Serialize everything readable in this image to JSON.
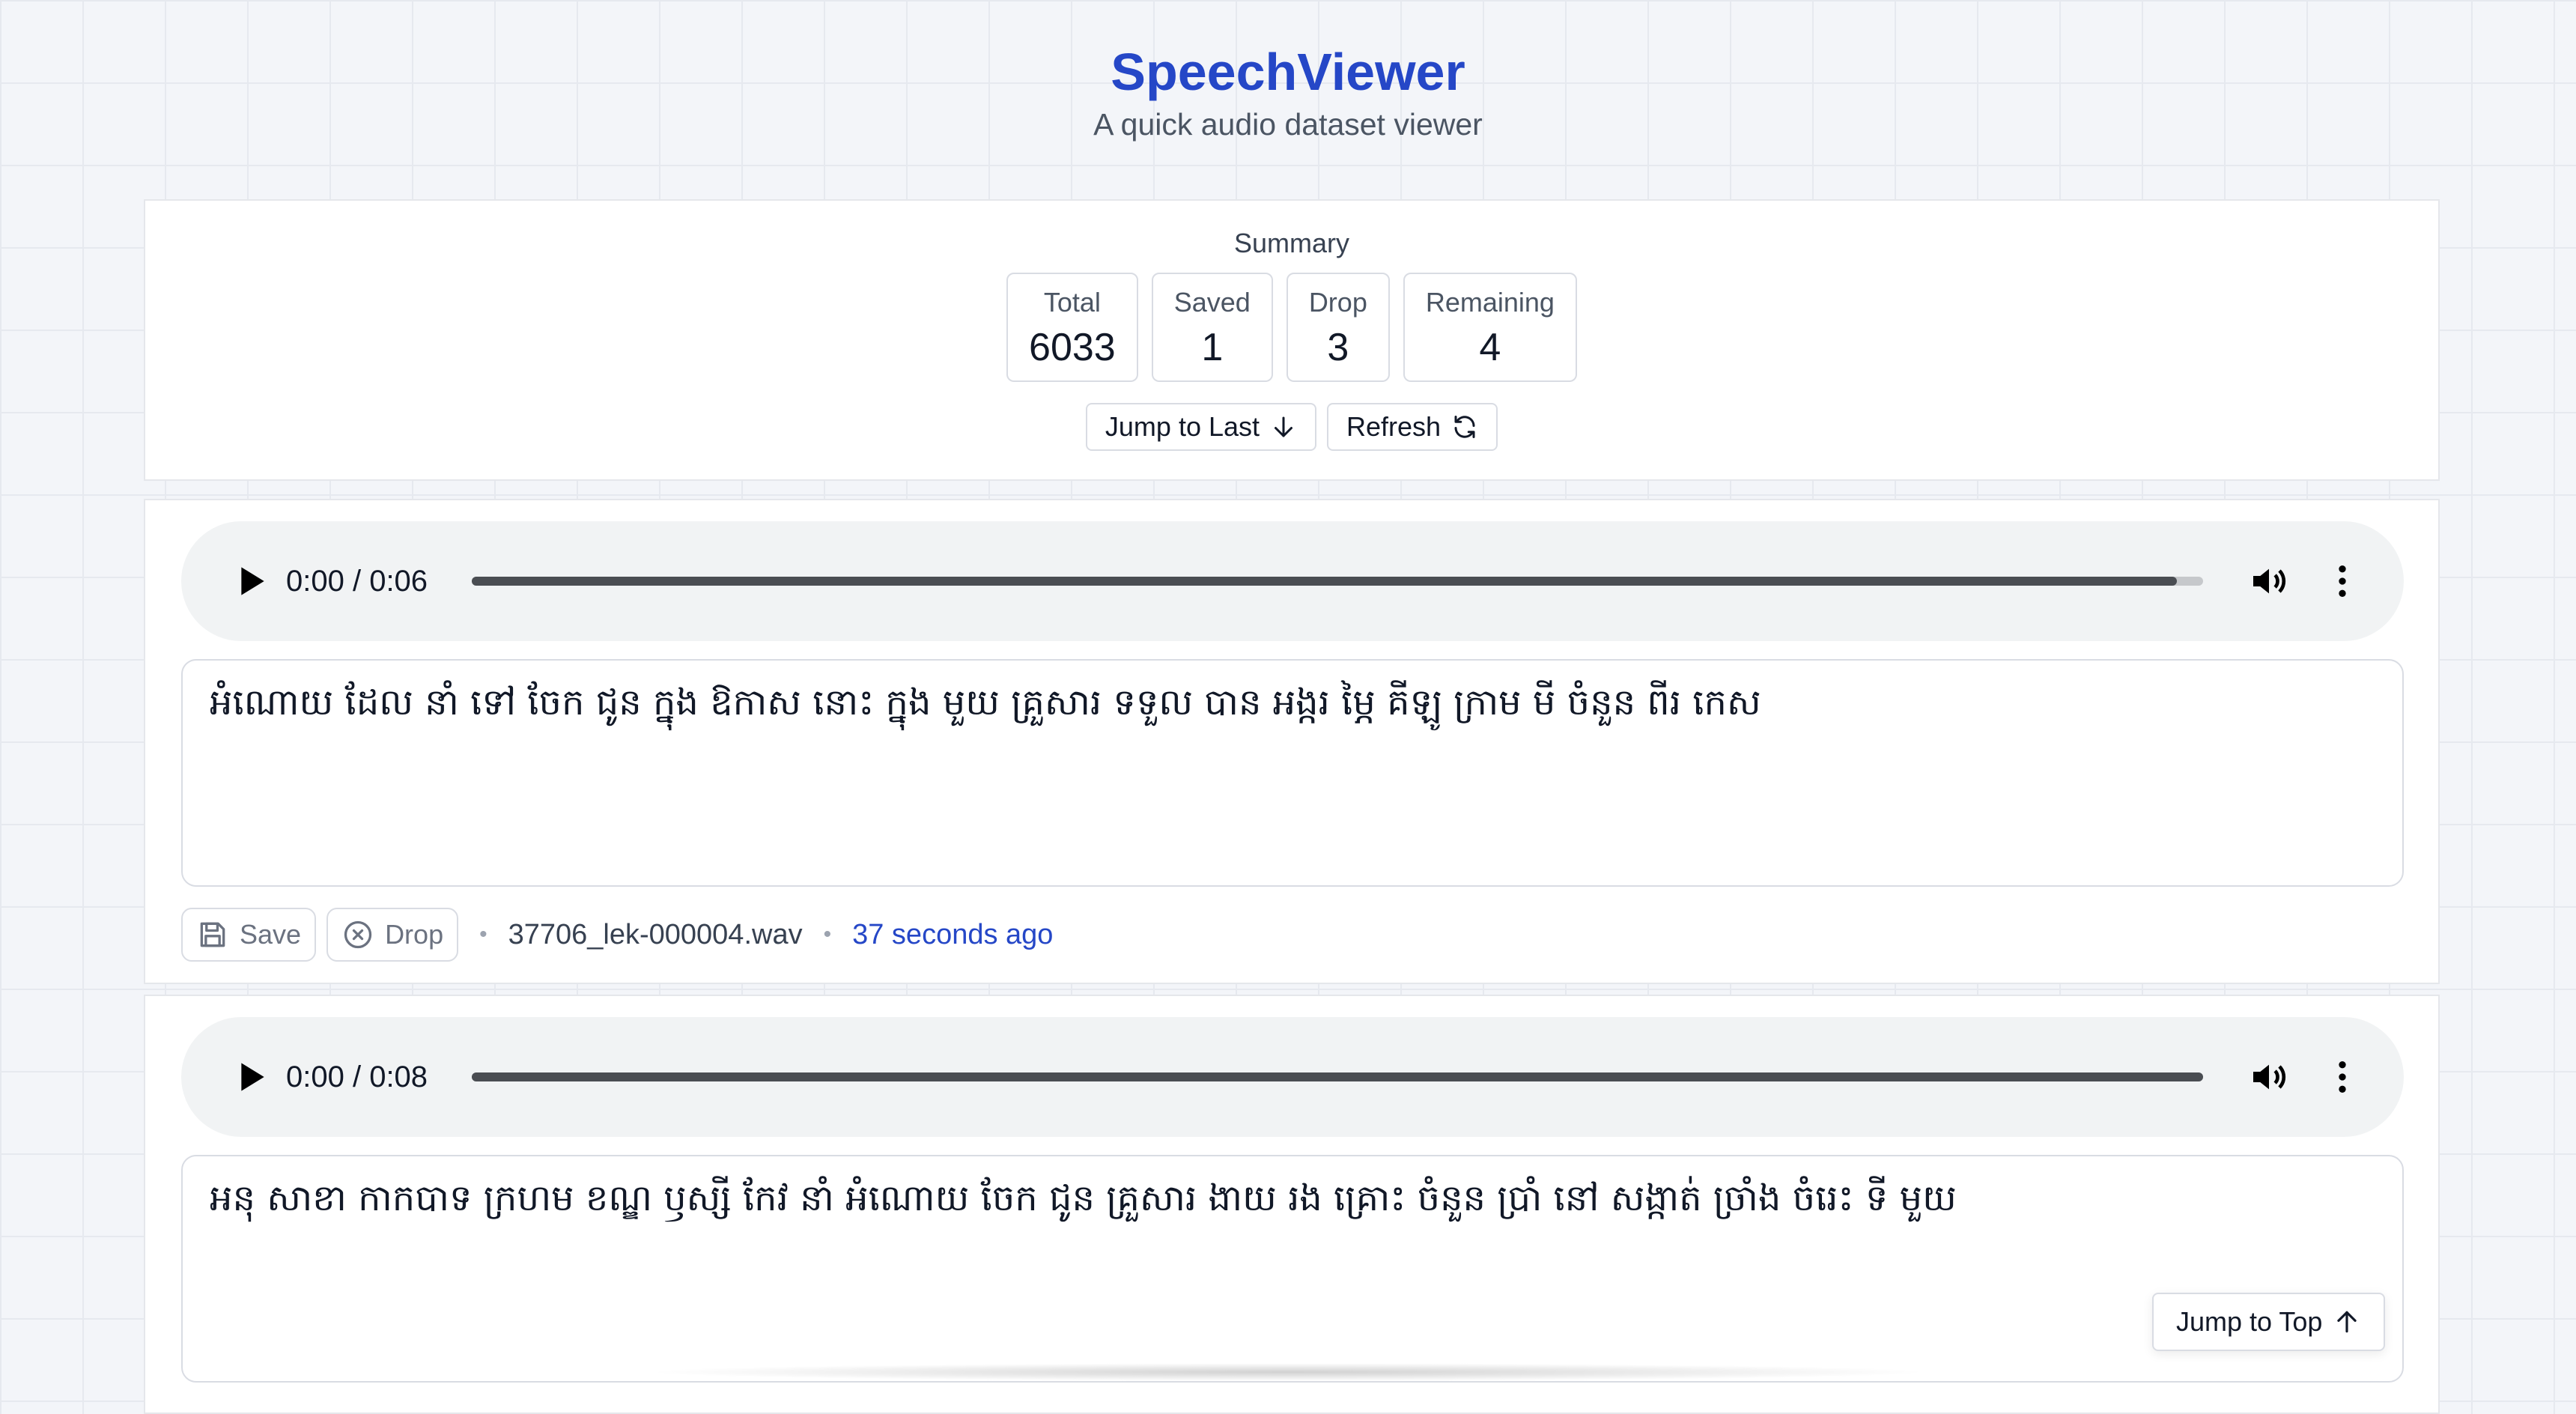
{
  "header": {
    "title": "SpeechViewer",
    "subtitle": "A quick audio dataset viewer"
  },
  "summary": {
    "label": "Summary",
    "stats": [
      {
        "label": "Total",
        "value": "6033"
      },
      {
        "label": "Saved",
        "value": "1"
      },
      {
        "label": "Drop",
        "value": "3"
      },
      {
        "label": "Remaining",
        "value": "4"
      }
    ],
    "jump_to_last_label": "Jump to Last",
    "refresh_label": "Refresh"
  },
  "items": [
    {
      "time": "0:00 / 0:06",
      "progress": 0.985,
      "transcript": "អំណោយ ដែល នាំ ទៅ ចែក ជូន ក្នុង ឱកាស នោះ ក្នុង មួយ គ្រួសារ ទទួល បាន អង្ករ ម្ភៃ គីឡូ ក្រាម មី ចំនួន ពីរ កេស",
      "save_label": "Save",
      "drop_label": "Drop",
      "filename": "37706_lek-000004.wav",
      "time_ago": "37 seconds ago"
    },
    {
      "time": "0:00 / 0:08",
      "progress": 1.0,
      "transcript": "អនុ សាខា កាកបាទ ក្រហម ខណ្ឌ ឫស្សី កែវ នាំ អំណោយ ចែក ជូន គ្រួសារ ងាយ រង គ្រោះ ចំនួន ប្រាំ នៅ សង្កាត់ ច្រាំង ចំរេះ ទី មួយ"
    }
  ],
  "jump_to_top_label": "Jump to Top",
  "icons": {
    "play": "play-icon",
    "volume": "volume-icon",
    "menu": "more-vertical-icon",
    "save": "floppy-disk-icon",
    "drop": "x-circle-icon",
    "jump_last": "arrow-down-icon",
    "refresh": "refresh-icon",
    "jump_top": "arrow-up-icon"
  },
  "colors": {
    "brand": "#2547c7",
    "background": "#f3f5f9",
    "player_bg": "#f1f3f4"
  }
}
